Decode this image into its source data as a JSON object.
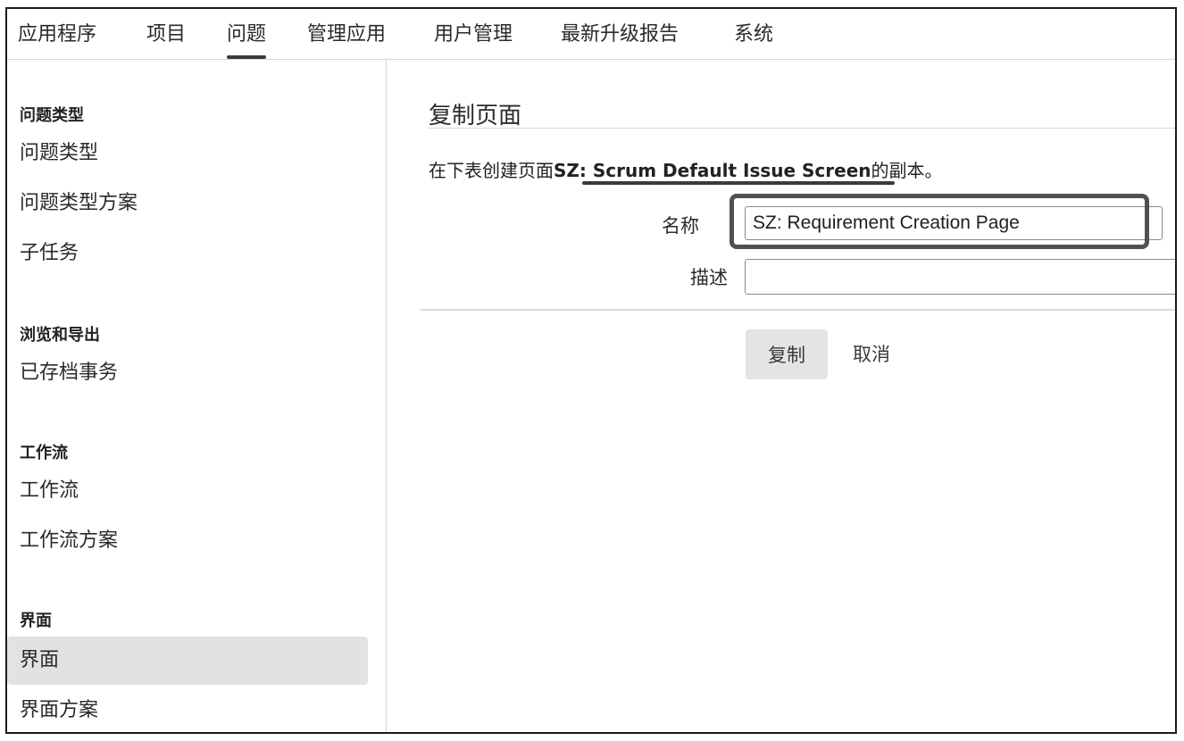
{
  "topnav": {
    "tabs": [
      {
        "label": "应用程序"
      },
      {
        "label": "项目"
      },
      {
        "label": "问题"
      },
      {
        "label": "管理应用"
      },
      {
        "label": "用户管理"
      },
      {
        "label": "最新升级报告"
      },
      {
        "label": "系统"
      }
    ],
    "active_tab": "问题"
  },
  "sidebar": {
    "sections": [
      {
        "heading": "问题类型",
        "items": [
          "问题类型",
          "问题类型方案",
          "子任务"
        ]
      },
      {
        "heading": "浏览和导出",
        "items": [
          "已存档事务"
        ]
      },
      {
        "heading": "工作流",
        "items": [
          "工作流",
          "工作流方案"
        ]
      },
      {
        "heading": "界面",
        "items": [
          "界面",
          "界面方案"
        ]
      }
    ],
    "selected_item": "界面"
  },
  "main": {
    "title": "复制页面",
    "description_prefix": "在下表创建页面",
    "screen_name": "SZ: Scrum Default Issue Screen",
    "description_suffix": "的副本。",
    "form": {
      "name_label": "名称",
      "name_value": "SZ: Requirement Creation Page",
      "desc_label": "描述",
      "desc_value": ""
    },
    "buttons": {
      "copy": "复制",
      "cancel": "取消"
    }
  },
  "colors": {
    "selected_bg": "#e2e2e2",
    "button_bg": "#e4e4e4",
    "highlight_border": "#505050"
  }
}
